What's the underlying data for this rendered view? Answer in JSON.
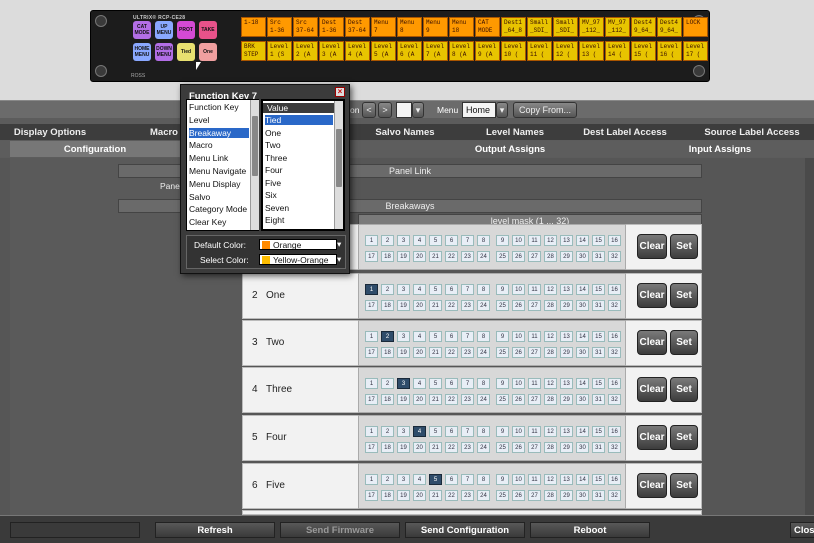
{
  "device": {
    "brand": "ULTRIX® RCP-CE28",
    "model": "ROSS",
    "buttons": [
      {
        "label": "CAT MODE",
        "color": "#b36ee6"
      },
      {
        "label": "UP MENU",
        "color": "#8aa8ff"
      },
      {
        "label": "PROT",
        "color": "#d44ad4"
      },
      {
        "label": "TAKE",
        "color": "#e8528a"
      },
      {
        "label": "HOME MENU",
        "color": "#8aa8ff"
      },
      {
        "label": "DOWN MENU",
        "color": "#b36ee6"
      },
      {
        "label": "Tied",
        "color": "#e8e070"
      },
      {
        "label": "One",
        "color": "#f0a0a0"
      }
    ],
    "lcd_top": [
      "1-18",
      "Src\n1-36",
      "Src\n37-64",
      "Dest\n1-36",
      "Dest\n37-64",
      "Menu\n7",
      "Menu\n8",
      "Menu\n9",
      "Menu\n18",
      "CAT\nMODE",
      "Dest1\n_64_8",
      "Small\n_SDI_",
      "Small\n_SDI_",
      "MV_97\n_112_",
      "MV_97\n_112_",
      "Dest4\n9_64_",
      "Dest4\n9_64_",
      "LOCK"
    ],
    "lcd_bottom": [
      "BRK\nSTEP",
      "Level\n1 (S",
      "Level\n2 (A",
      "Level\n3 (A",
      "Level\n4 (A",
      "Level\n5 (A",
      "Level\n6 (A",
      "Level\n7 (A",
      "Level\n8 (A",
      "Level\n9 (A",
      "Level\n10 (",
      "Level\n11 (",
      "Level\n12 (",
      "Level\n13 (",
      "Level\n14 (",
      "Level\n15 (",
      "Level\n16 (",
      "Level\n17 ("
    ]
  },
  "toolbar": {
    "nav_label": "on",
    "prev": "<",
    "next": ">",
    "menu_label": "Menu",
    "menu_value": "Home",
    "copy_button": "Copy From..."
  },
  "tabs_row1": [
    "Display Options",
    "Macro",
    "Salvo Names",
    "Level Names",
    "Dest Label Access",
    "Source Label Access"
  ],
  "tabs_row2": [
    "Configuration",
    "Output Assigns",
    "Input Assigns"
  ],
  "sections": {
    "panel_link": "Panel Link",
    "panel_label": "Pane",
    "breakaways": "Breakaways",
    "level_mask": "level mask (1 ... 32)"
  },
  "rows": [
    {
      "num": "",
      "name": "",
      "on": 0
    },
    {
      "num": "2",
      "name": "One",
      "on": 1
    },
    {
      "num": "3",
      "name": "Two",
      "on": 2
    },
    {
      "num": "4",
      "name": "Three",
      "on": 3
    },
    {
      "num": "5",
      "name": "Four",
      "on": 4
    },
    {
      "num": "6",
      "name": "Five",
      "on": 5
    }
  ],
  "clear_label": "Clear",
  "set_label": "Set",
  "bottom": {
    "refresh": "Refresh",
    "send_firmware": "Send Firmware",
    "send_configuration": "Send Configuration",
    "reboot": "Reboot",
    "close": "Close"
  },
  "popup": {
    "title": "Function Key 7",
    "left_list": [
      "Function Key",
      "Level",
      "Breakaway",
      "Macro",
      "Menu Link",
      "Menu Navigate",
      "Menu Display",
      "Salvo",
      "Category Mode",
      "Clear Key"
    ],
    "left_selected": 2,
    "value_header": "Value",
    "value_list": [
      "Tied",
      "One",
      "Two",
      "Three",
      "Four",
      "Five",
      "Six",
      "Seven",
      "Eight"
    ],
    "value_selected": 0,
    "default_color_label": "Default Color:",
    "default_color_value": "Orange",
    "default_color_swatch": "#ff8a00",
    "select_color_label": "Select Color:",
    "select_color_value": "Yellow-Orange",
    "select_color_swatch": "#ffbe00"
  }
}
